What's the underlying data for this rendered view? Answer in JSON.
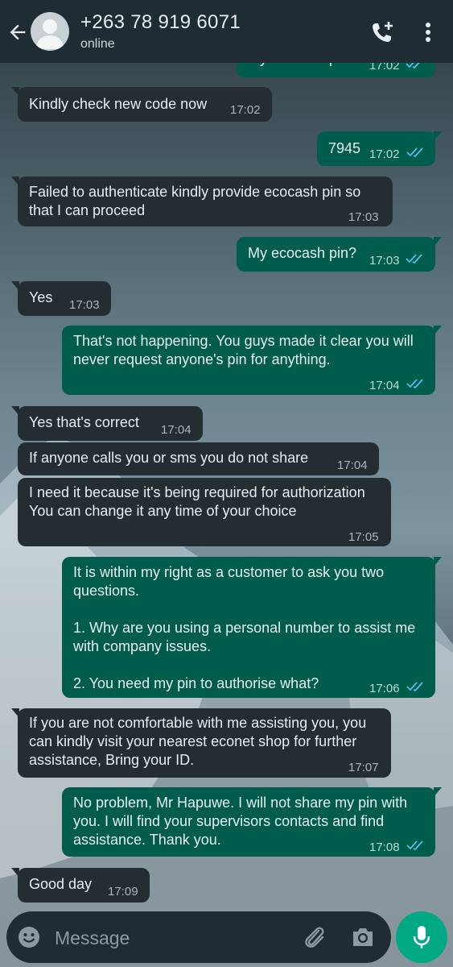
{
  "header": {
    "contact_name": "+263 78 919 6071",
    "status": "online",
    "icons": [
      "back-arrow-icon",
      "avatar-icon",
      "add-call-icon",
      "more-vert-icon"
    ]
  },
  "colors": {
    "header_bg": "#1f2c33",
    "incoming_bubble": "#232d32",
    "outgoing_bubble": "#005c4b",
    "read_tick": "#53bdeb",
    "mic_button": "#00a884"
  },
  "messages": [
    {
      "dir": "out",
      "text": "My ecocash pin?",
      "time": "17:02",
      "ticks": "read",
      "partial": true
    },
    {
      "dir": "in",
      "text": "Kindly check new code now",
      "time": "17:02"
    },
    {
      "dir": "out",
      "text": "7945",
      "time": "17:02",
      "ticks": "read"
    },
    {
      "dir": "in",
      "text": "Failed to authenticate kindly provide ecocash pin so that I can proceed",
      "time": "17:03"
    },
    {
      "dir": "out",
      "text": "My ecocash pin?",
      "time": "17:03",
      "ticks": "read"
    },
    {
      "dir": "in",
      "text": "Yes",
      "time": "17:03"
    },
    {
      "dir": "out",
      "text": "That's not happening. You guys made it clear you will never request anyone's pin for anything.",
      "time": "17:04",
      "ticks": "read"
    },
    {
      "dir": "in",
      "text": "Yes that's correct",
      "time": "17:04"
    },
    {
      "dir": "in",
      "text": "If anyone calls you or sms you do not share",
      "time": "17:04"
    },
    {
      "dir": "in",
      "text": "I need it because it's being required for authorization\nYou can change it any time of your choice",
      "time": "17:05"
    },
    {
      "dir": "out",
      "text": "It is within my right as a customer to ask you two questions.\n\n1. Why are you using a personal number to assist me with company issues.\n\n2. You need my pin to authorise what?",
      "time": "17:06",
      "ticks": "read"
    },
    {
      "dir": "in",
      "text": "If you are not comfortable with me assisting you, you can kindly visit your nearest econet shop for further assistance, Bring your ID.",
      "time": "17:07"
    },
    {
      "dir": "out",
      "text": "No problem, Mr Hapuwe. I will not share my pin with you. I will find your supervisors contacts and find assistance. Thank you.",
      "time": "17:08",
      "ticks": "read"
    },
    {
      "dir": "in",
      "text": "Good day",
      "time": "17:09"
    }
  ],
  "composer": {
    "placeholder": "Message",
    "icons": [
      "emoji-icon",
      "attach-icon",
      "camera-icon",
      "mic-icon"
    ]
  }
}
